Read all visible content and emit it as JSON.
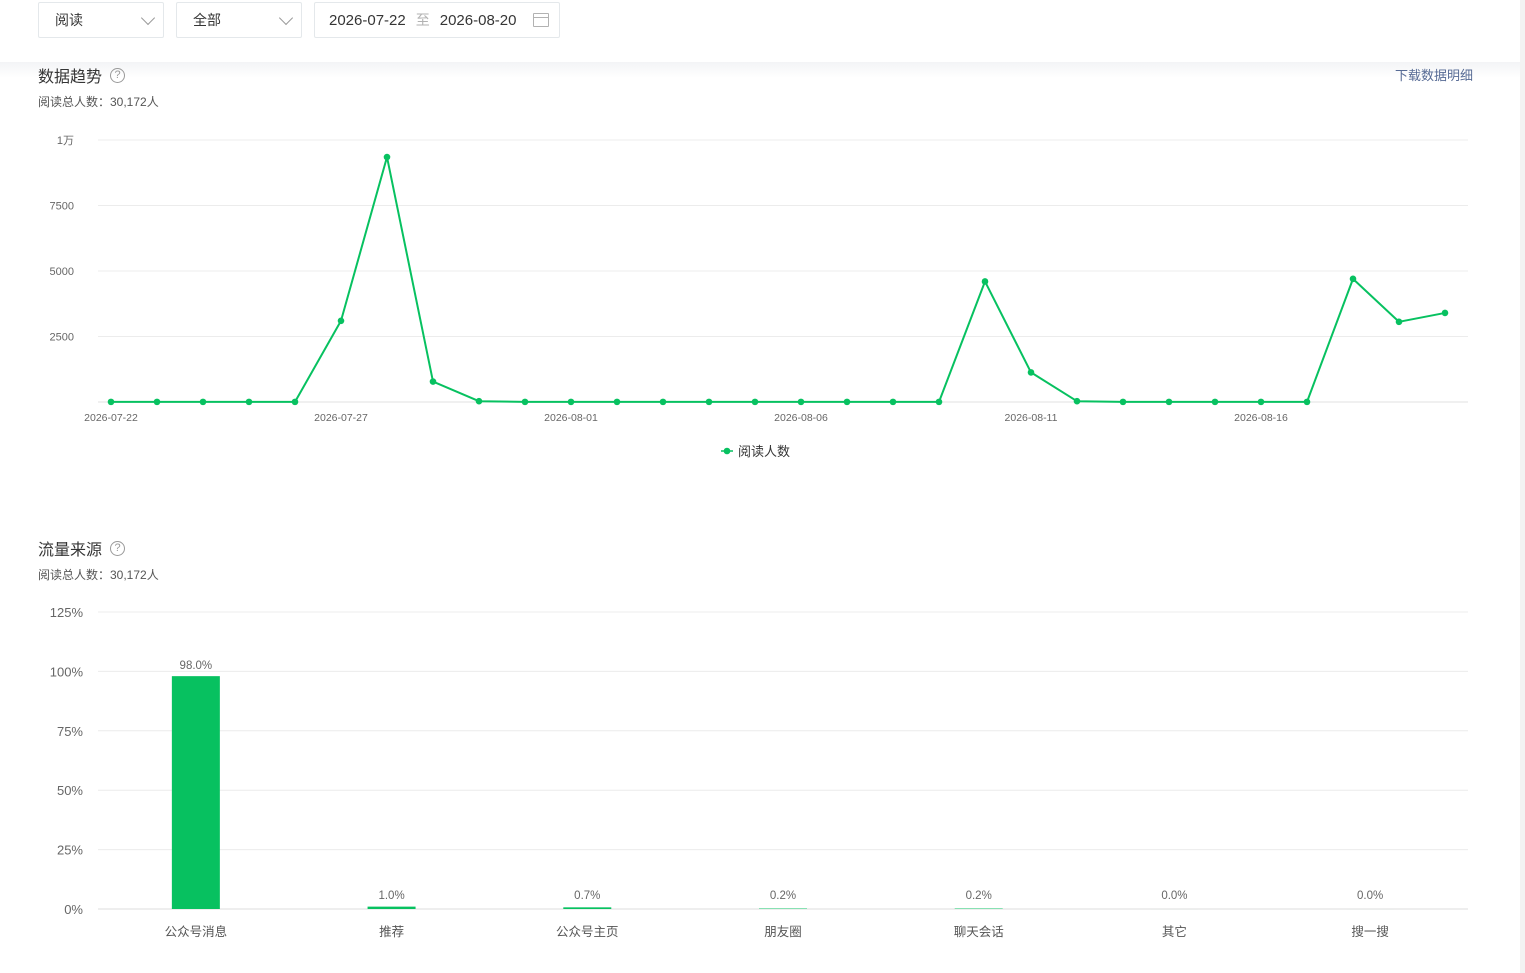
{
  "filters": {
    "type_select": "阅读",
    "scope_select": "全部",
    "date_start": "2026-07-22",
    "date_separator": "至",
    "date_end": "2026-08-20"
  },
  "trend": {
    "title": "数据趋势",
    "help": "?",
    "subtitle": "阅读总人数：30,172人",
    "download_label": "下载数据明细"
  },
  "source": {
    "title": "流量来源",
    "help": "?",
    "subtitle": "阅读总人数：30,172人"
  },
  "colors": {
    "accent": "#07c160",
    "grid": "#ececec",
    "link": "#576b95"
  },
  "chart_data": [
    {
      "type": "line",
      "title": "",
      "series": [
        {
          "name": "阅读人数",
          "x": [
            "2026-07-22",
            "2026-07-23",
            "2026-07-24",
            "2026-07-25",
            "2026-07-26",
            "2026-07-27",
            "2026-07-28",
            "2026-07-29",
            "2026-07-30",
            "2026-07-31",
            "2026-08-01",
            "2026-08-02",
            "2026-08-03",
            "2026-08-04",
            "2026-08-05",
            "2026-08-06",
            "2026-08-07",
            "2026-08-08",
            "2026-08-09",
            "2026-08-10",
            "2026-08-11",
            "2026-08-12",
            "2026-08-13",
            "2026-08-14",
            "2026-08-15",
            "2026-08-16",
            "2026-08-17",
            "2026-08-18",
            "2026-08-19",
            "2026-08-20"
          ],
          "values": [
            5,
            5,
            5,
            5,
            5,
            3100,
            9350,
            780,
            30,
            5,
            5,
            5,
            5,
            5,
            5,
            5,
            5,
            5,
            5,
            4600,
            1130,
            30,
            5,
            5,
            5,
            5,
            5,
            4700,
            3060,
            3400
          ]
        }
      ],
      "x_tick_labels": [
        "2026-07-22",
        "2026-07-27",
        "2026-08-01",
        "2026-08-06",
        "2026-08-11",
        "2026-08-16"
      ],
      "y_ticks": [
        2500,
        5000,
        7500,
        10000
      ],
      "y_tick_labels": [
        "2500",
        "5000",
        "7500",
        "1万"
      ],
      "ylim": [
        0,
        10000
      ],
      "grid": true,
      "legend": "bottom-center"
    },
    {
      "type": "bar",
      "title": "",
      "categories": [
        "公众号消息",
        "推荐",
        "公众号主页",
        "朋友圈",
        "聊天会话",
        "其它",
        "搜一搜"
      ],
      "values": [
        98.0,
        1.0,
        0.7,
        0.2,
        0.2,
        0.0,
        0.0
      ],
      "value_labels": [
        "98.0%",
        "1.0%",
        "0.7%",
        "0.2%",
        "0.2%",
        "0.0%",
        "0.0%"
      ],
      "y_tick_labels": [
        "0%",
        "25%",
        "50%",
        "75%",
        "100%",
        "125%"
      ],
      "ylim": [
        0,
        125
      ],
      "grid": true
    }
  ]
}
